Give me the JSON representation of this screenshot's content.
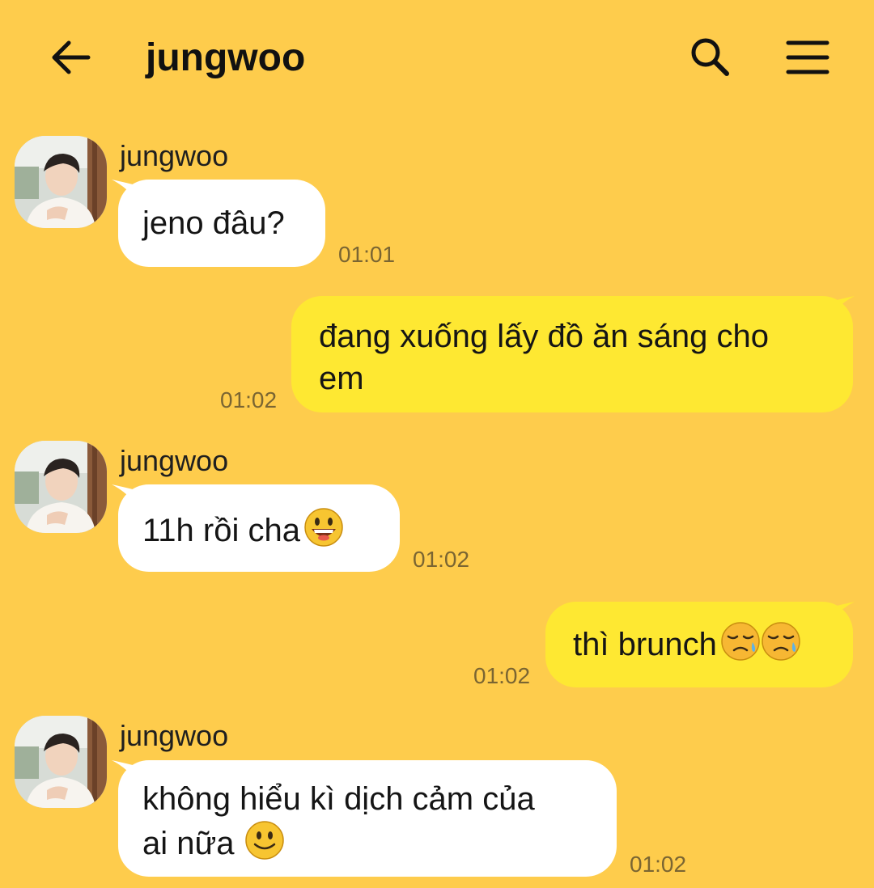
{
  "header": {
    "title": "jungwoo",
    "back_icon": "arrow-left-icon",
    "search_icon": "search-icon",
    "menu_icon": "hamburger-menu-icon"
  },
  "colors": {
    "background": "#fecc4c",
    "incoming_bubble": "#ffffff",
    "outgoing_bubble": "#fee832",
    "time_text": "#7a6532"
  },
  "messages": [
    {
      "direction": "in",
      "sender": "jungwoo",
      "text": "jeno đâu?",
      "time": "01:01"
    },
    {
      "direction": "out",
      "text_line1": "đang xuống lấy đồ ăn sáng cho",
      "text_line2": "em",
      "time": "01:02"
    },
    {
      "direction": "in",
      "sender": "jungwoo",
      "text": "11h rồi cha",
      "emoji": "grinning-face-icon",
      "time": "01:02"
    },
    {
      "direction": "out",
      "text": "thì brunch",
      "emoji": "sad-but-relieved-face-icon",
      "time": "01:02"
    },
    {
      "direction": "in",
      "sender": "jungwoo",
      "text_line1": "không hiểu kì dịch cảm của",
      "text_line2": "ai nữa",
      "emoji": "slightly-smiling-face-icon",
      "time": "01:02"
    }
  ]
}
